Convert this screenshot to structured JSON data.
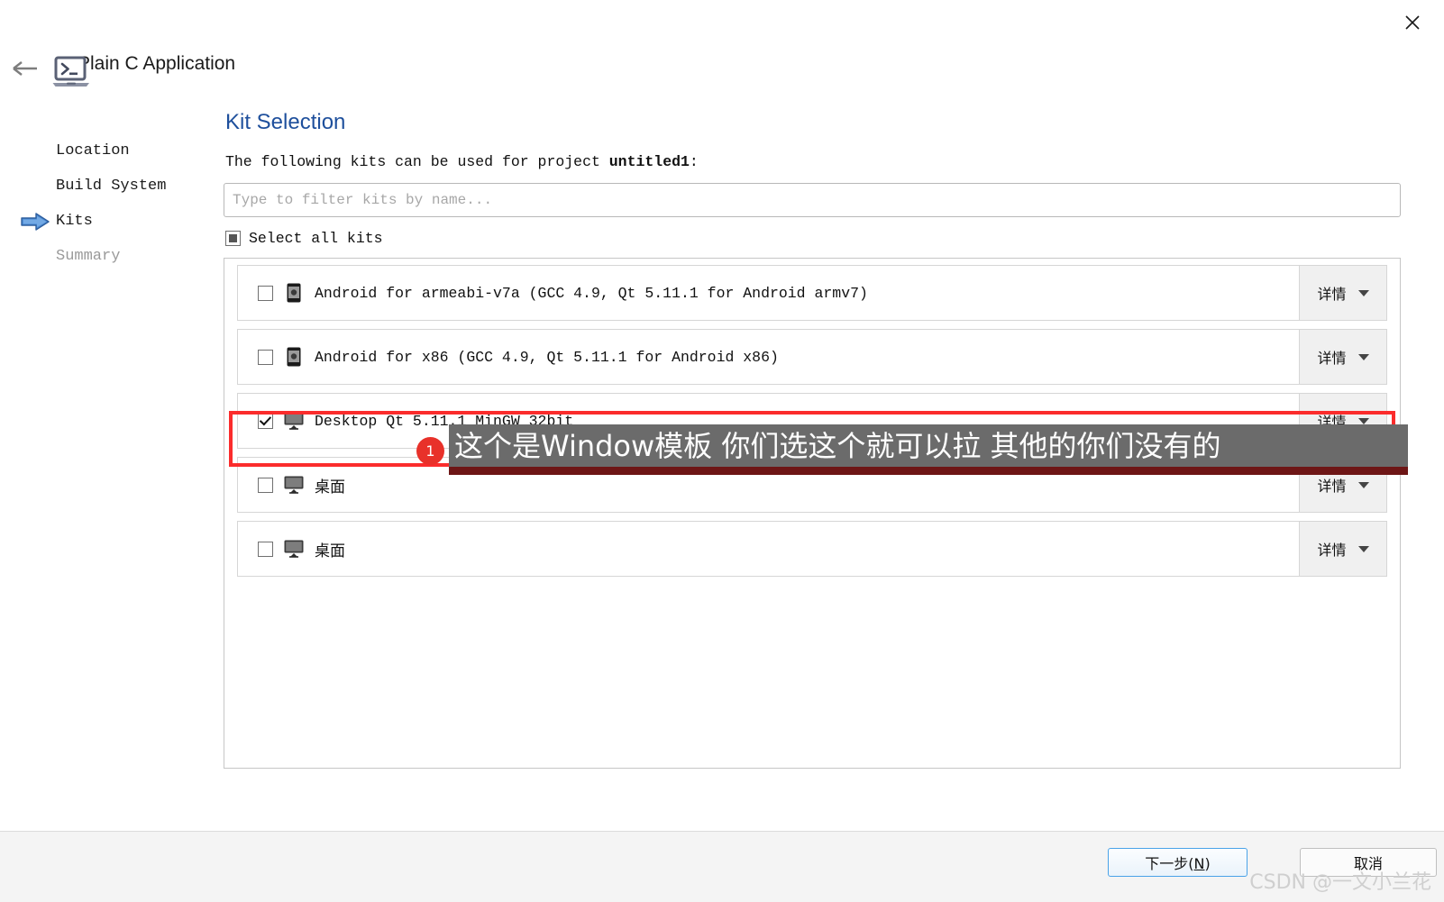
{
  "window": {
    "app_title": "Plain C Application",
    "close_label": "✕",
    "back_label": "←"
  },
  "sidebar": {
    "items": [
      {
        "label": "Location",
        "active": false,
        "dim": false
      },
      {
        "label": "Build System",
        "active": false,
        "dim": false
      },
      {
        "label": "Kits",
        "active": true,
        "dim": false
      },
      {
        "label": "Summary",
        "active": false,
        "dim": true
      }
    ]
  },
  "main": {
    "page_title": "Kit Selection",
    "subtitle_prefix": "The following kits can be used for project ",
    "project_name": "untitled1",
    "subtitle_suffix": ":",
    "filter_placeholder": "Type to filter kits by name...",
    "filter_value": "",
    "select_all_label": "Select all kits",
    "select_all_state": "partial",
    "detail_button_label": "详情",
    "kits": [
      {
        "label": "Android for armeabi-v7a (GCC 4.9, Qt 5.11.1 for Android armv7)",
        "icon": "android-phone-icon",
        "checked": false,
        "cjk": false
      },
      {
        "label": "Android for x86 (GCC 4.9, Qt 5.11.1 for Android x86)",
        "icon": "android-phone-icon",
        "checked": false,
        "cjk": false
      },
      {
        "label": "Desktop Qt 5.11.1 MinGW 32bit",
        "icon": "desktop-monitor-icon",
        "checked": true,
        "cjk": false
      },
      {
        "label": "桌面",
        "icon": "desktop-monitor-icon",
        "checked": false,
        "cjk": true
      },
      {
        "label": "桌面",
        "icon": "desktop-monitor-icon",
        "checked": false,
        "cjk": true
      }
    ]
  },
  "annotation": {
    "badge": "1",
    "text": "这个是Window模板 你们选这个就可以拉 其他的你们没有的",
    "highlight_color": "#fb2c2c"
  },
  "footer": {
    "next_label_pre": "下一步(",
    "next_accel": "N",
    "next_label_post": ")",
    "cancel_label": "取消"
  },
  "watermark": {
    "text": "CSDN @一文小兰花"
  }
}
